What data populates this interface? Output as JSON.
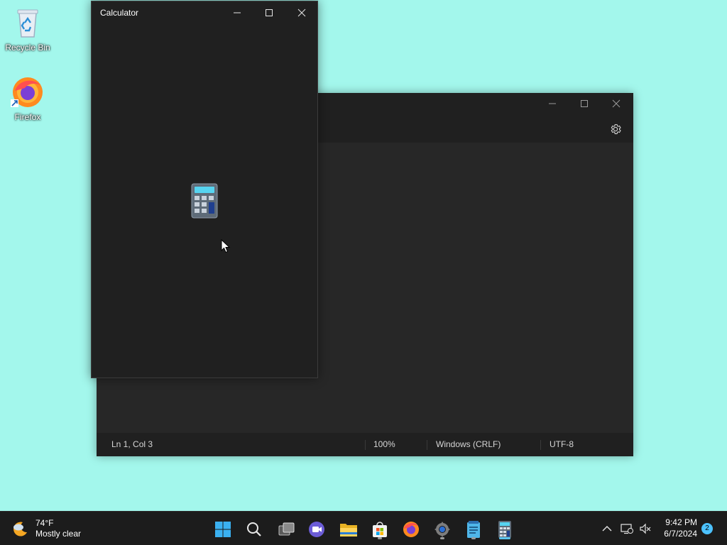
{
  "desktop": {
    "icons": [
      {
        "label": "Recycle Bin"
      },
      {
        "label": "Firefox"
      }
    ]
  },
  "notepad": {
    "status": {
      "position": "Ln 1, Col 3",
      "zoom": "100%",
      "line_ending": "Windows (CRLF)",
      "encoding": "UTF-8"
    }
  },
  "calculator": {
    "title": "Calculator"
  },
  "taskbar": {
    "weather": {
      "temp": "74°F",
      "condition": "Mostly clear"
    },
    "apps": [
      "start",
      "search",
      "task-view",
      "meet",
      "file-explorer",
      "microsoft-store",
      "firefox",
      "settings",
      "notepad",
      "calculator"
    ],
    "clock": {
      "time": "9:42 PM",
      "date": "6/7/2024"
    },
    "notification_count": "2"
  },
  "colors": {
    "desktop_bg": "#a3f7ec",
    "window_bg": "#202020",
    "taskbar_bg": "#1c1c1c",
    "accent": "#4cc2ff"
  }
}
